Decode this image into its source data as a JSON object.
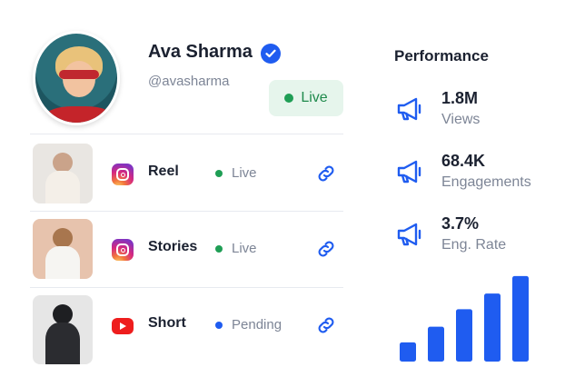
{
  "profile": {
    "name": "Ava Sharma",
    "handle": "@avasharma",
    "status": "Live",
    "verified": true
  },
  "content_rows": [
    {
      "type": "Reel",
      "platform_icon": "instagram-icon",
      "status": "Live",
      "status_color": "#1f9e55",
      "thumb_bg": "#e9e6e2",
      "figure_color": "#f4efe8"
    },
    {
      "type": "Stories",
      "platform_icon": "instagram-icon",
      "status": "Live",
      "status_color": "#1f9e55",
      "thumb_bg": "#e7c3ad",
      "figure_color": "#f6f5f2"
    },
    {
      "type": "Short",
      "platform_icon": "youtube-icon",
      "status": "Pending",
      "status_color": "#1f5cf0",
      "thumb_bg": "#e6e6e6",
      "figure_color": "#2b2c30"
    }
  ],
  "performance": {
    "title": "Performance",
    "stats": [
      {
        "value": "1.8M",
        "label": "Views",
        "icon": "megaphone-icon"
      },
      {
        "value": "68.4K",
        "label": "Engagements",
        "icon": "megaphone-icon"
      },
      {
        "value": "3.7%",
        "label": "Eng. Rate",
        "icon": "megaphone-icon"
      }
    ],
    "bar_levels": [
      0.22,
      0.4,
      0.6,
      0.78,
      0.98
    ]
  },
  "colors": {
    "accent": "#1f5cf0",
    "live_green": "#1f9e55",
    "live_badge_bg": "#e6f5ec",
    "muted_text": "#7d8596"
  }
}
